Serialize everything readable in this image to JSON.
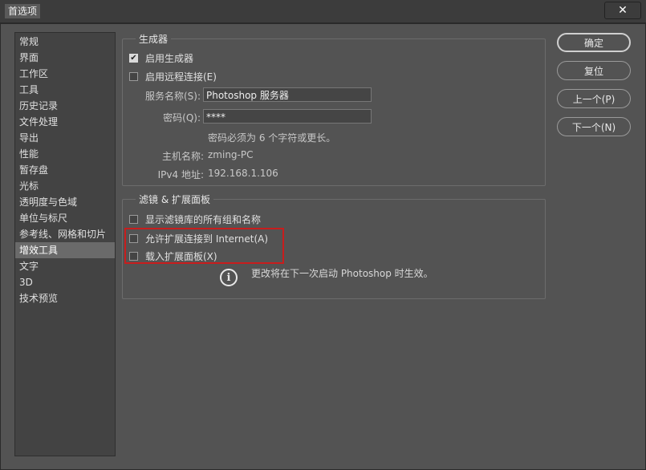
{
  "window": {
    "title": "首选项",
    "close_glyph": "✕"
  },
  "sidebar": {
    "items": [
      {
        "label": "常规"
      },
      {
        "label": "界面"
      },
      {
        "label": "工作区"
      },
      {
        "label": "工具"
      },
      {
        "label": "历史记录"
      },
      {
        "label": "文件处理"
      },
      {
        "label": "导出"
      },
      {
        "label": "性能"
      },
      {
        "label": "暂存盘"
      },
      {
        "label": "光标"
      },
      {
        "label": "透明度与色域"
      },
      {
        "label": "单位与标尺"
      },
      {
        "label": "参考线、网格和切片"
      },
      {
        "label": "增效工具",
        "selected": true
      },
      {
        "label": "文字"
      },
      {
        "label": "3D"
      },
      {
        "label": "技术预览"
      }
    ]
  },
  "generator": {
    "legend": "生成器",
    "enable_generator": {
      "label": "启用生成器",
      "checked": true
    },
    "enable_remote": {
      "label": "启用远程连接(E)",
      "checked": false
    },
    "service_name_label": "服务名称(S):",
    "service_name_value": "Photoshop 服务器",
    "password_label": "密码(Q):",
    "password_value": "****",
    "password_hint": "密码必须为 6 个字符或更长。",
    "hostname_label": "主机名称:",
    "hostname_value": "zming-PC",
    "ipv4_label": "IPv4 地址:",
    "ipv4_value": "192.168.1.106"
  },
  "filters": {
    "legend": "滤镜 & 扩展面板",
    "show_all_groups": {
      "label": "显示滤镜库的所有组和名称",
      "checked": false
    },
    "allow_internet": {
      "label": "允许扩展连接到 Internet(A)",
      "checked": false
    },
    "load_panels": {
      "label": "载入扩展面板(X)",
      "checked": false
    },
    "restart_note": "更改将在下一次启动 Photoshop 时生效。",
    "info_glyph": "i"
  },
  "buttons": {
    "ok": "确定",
    "reset": "复位",
    "prev": "上一个(P)",
    "next": "下一个(N)"
  },
  "colors": {
    "background": "#535353",
    "highlight_box": "#c81d1d"
  }
}
